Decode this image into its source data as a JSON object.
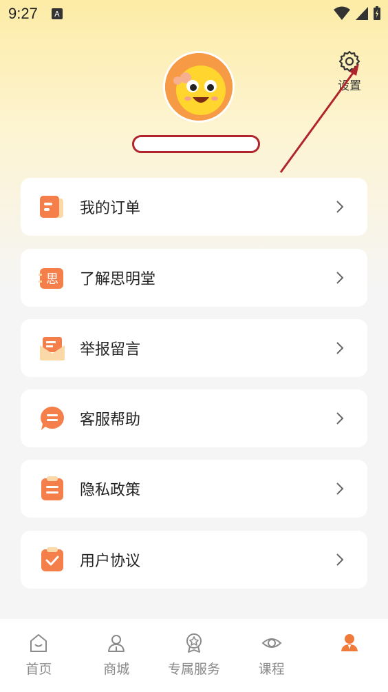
{
  "status_bar": {
    "time": "9:27",
    "notif_letter": "A"
  },
  "header": {
    "settings_label": "设置"
  },
  "colors": {
    "accent": "#f07a3a",
    "annotation": "#b0242c",
    "icon_orange": "#f47f4a"
  },
  "menu": [
    {
      "label": "我的订单",
      "icon": "order-icon"
    },
    {
      "label": "了解思明堂",
      "icon": "about-icon",
      "icon_text": "思"
    },
    {
      "label": "举报留言",
      "icon": "envelope-icon"
    },
    {
      "label": "客服帮助",
      "icon": "chat-icon"
    },
    {
      "label": "隐私政策",
      "icon": "clipboard-icon"
    },
    {
      "label": "用户协议",
      "icon": "agreement-icon"
    }
  ],
  "tabs": [
    {
      "label": "首页",
      "icon": "home-icon",
      "active": false
    },
    {
      "label": "商城",
      "icon": "user-outline-icon",
      "active": false
    },
    {
      "label": "专属服务",
      "icon": "badge-icon",
      "active": false
    },
    {
      "label": "课程",
      "icon": "eye-icon",
      "active": false
    },
    {
      "label": "",
      "icon": "profile-icon",
      "active": true
    }
  ]
}
